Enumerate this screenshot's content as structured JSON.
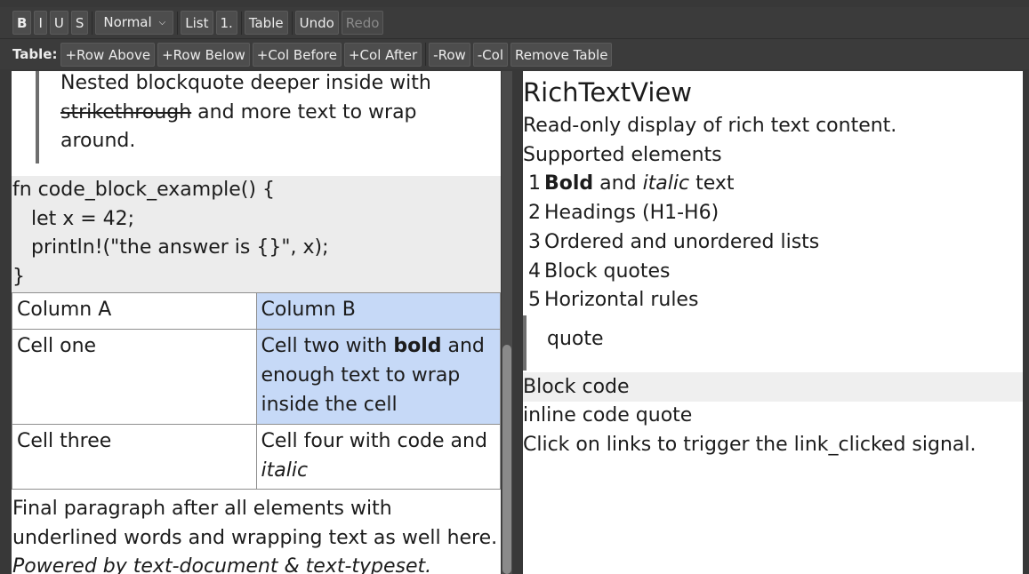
{
  "toolbar": {
    "bold": "B",
    "italic": "I",
    "underline": "U",
    "strike": "S",
    "style_select": "Normal",
    "list": "List",
    "ordered_list": "1.",
    "table": "Table",
    "undo": "Undo",
    "redo": "Redo"
  },
  "table_toolbar": {
    "label": "Table:",
    "row_above": "+Row Above",
    "row_below": "+Row Below",
    "col_before": "+Col Before",
    "col_after": "+Col After",
    "remove_row": "-Row",
    "remove_col": "-Col",
    "remove_table": "Remove Table"
  },
  "editor": {
    "blockquote": {
      "part1": "Nested blockquote deeper inside with",
      "strike": "strikethrough",
      "part2": " and more text to wrap",
      "part3": "around."
    },
    "code_lines": [
      "fn code_block_example() {",
      "   let x = 42;",
      "   println!(\"the answer is {}\", x);",
      "}"
    ],
    "table": {
      "r0c0": "Column A",
      "r0c1": "Column B",
      "r1c0": "Cell one",
      "r1c1_pre": "Cell two with ",
      "r1c1_bold": "bold",
      "r1c1_post": " and enough text to wrap inside the cell",
      "r2c0": "Cell three",
      "r2c1_pre": "Cell four with code and ",
      "r2c1_italic": "italic"
    },
    "final_paragraph": "Final paragraph after all elements with underlined words and wrapping text as well here. ",
    "final_italic": "Powered by text-document & text-typeset."
  },
  "viewer": {
    "title": "RichTextView",
    "subtitle": "Read-only display of rich text content.",
    "supported_heading": "Supported elements",
    "list": [
      {
        "num": "1",
        "bold": "Bold",
        "mid": " and ",
        "italic": "italic",
        "end": " text"
      },
      {
        "num": "2",
        "text": "Headings (H1-H6)"
      },
      {
        "num": "3",
        "text": "Ordered and unordered lists"
      },
      {
        "num": "4",
        "text": "Block quotes"
      },
      {
        "num": "5",
        "text": "Horizontal rules"
      }
    ],
    "quote": "quote",
    "block_code": "Block code",
    "inline_code": "inline code quote",
    "links_text": "Click on links to trigger the link_clicked signal."
  },
  "colors": {
    "background": "#383838",
    "toolbar_button": "#4d4d4d",
    "selection": "#c6d9f7",
    "code_background": "#ececec",
    "quote_bar": "#6e6e6e"
  }
}
